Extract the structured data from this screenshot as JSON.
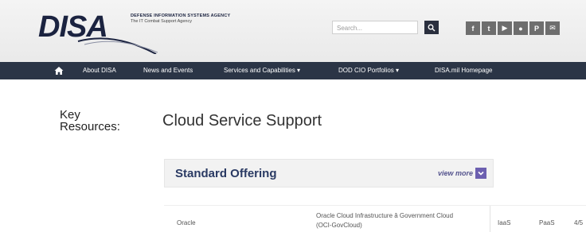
{
  "header": {
    "logo_text": "DISA",
    "agency_name": "DEFENSE INFORMATION SYSTEMS AGENCY",
    "agency_tagline": "The IT Combat Support Agency",
    "search_placeholder": "Search...",
    "social_icons": [
      "facebook-icon",
      "twitter-icon",
      "youtube-icon",
      "flickr-icon",
      "pinterest-icon",
      "email-icon"
    ],
    "social_glyphs": [
      "f",
      "t",
      "▶",
      "●",
      "P",
      "✉"
    ]
  },
  "nav": {
    "items": [
      {
        "label": "About DISA"
      },
      {
        "label": "News and Events"
      },
      {
        "label": "Services and Capabilities ▾"
      },
      {
        "label": "DOD CIO Portfolios ▾"
      },
      {
        "label": "DISA.mil Homepage"
      }
    ]
  },
  "content": {
    "key_resources_line1": "Key",
    "key_resources_line2": "Resources:",
    "page_title": "Cloud Service Support",
    "offering_title": "Standard Offering",
    "view_more": "view more",
    "table_row": {
      "provider": "Oracle",
      "offering_line1": "Oracle Cloud Infrastructure â Government Cloud",
      "offering_line2": "(OCI-GovCloud)",
      "iaas": "IaaS",
      "paas": "PaaS",
      "extra": "4/5"
    }
  },
  "colors": {
    "nav_bg": "#2b3546",
    "brand_navy": "#1b2340",
    "offering_title": "#2a3a63",
    "view_more_accent": "#6c5fb0"
  }
}
